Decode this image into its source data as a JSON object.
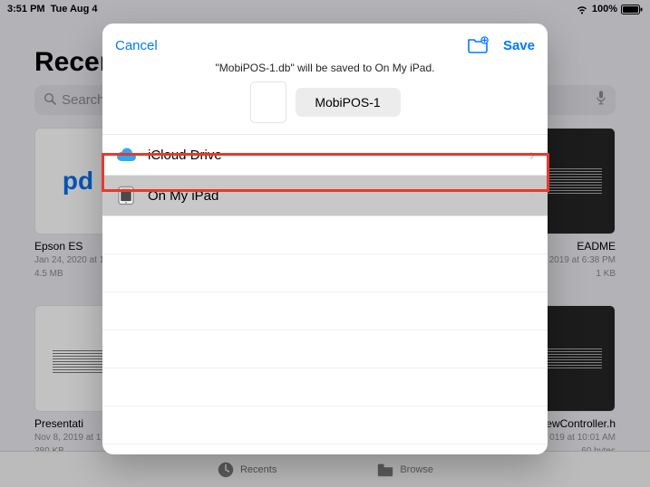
{
  "status": {
    "time": "3:51 PM",
    "date": "Tue Aug 4",
    "battery_pct": "100%"
  },
  "bg": {
    "title": "Recents",
    "search_placeholder": "Search",
    "files": [
      {
        "name": "Epson ES",
        "date": "Jan 24, 2020 at 1",
        "size": "4.5 MB"
      },
      {
        "name": "EADME",
        "date": "2019 at 6:38 PM",
        "size": "1 KB"
      },
      {
        "name": "Presentati",
        "date": "Nov 8, 2019 at 1",
        "size": "380 KB"
      },
      {
        "name": "ewController.h",
        "date": "019 at 10:01 AM",
        "size": "60 bytes"
      }
    ]
  },
  "tabbar": {
    "recents": "Recents",
    "browse": "Browse"
  },
  "modal": {
    "cancel": "Cancel",
    "save": "Save",
    "subtitle": "\"MobiPOS-1.db\" will be saved to On My iPad.",
    "filename": "MobiPOS-1",
    "locations": [
      {
        "label": "iCloud Drive",
        "icon": "cloud"
      },
      {
        "label": "On My iPad",
        "icon": "ipad"
      }
    ]
  },
  "colors": {
    "accent": "#007aff",
    "highlight": "#e43a2d"
  }
}
